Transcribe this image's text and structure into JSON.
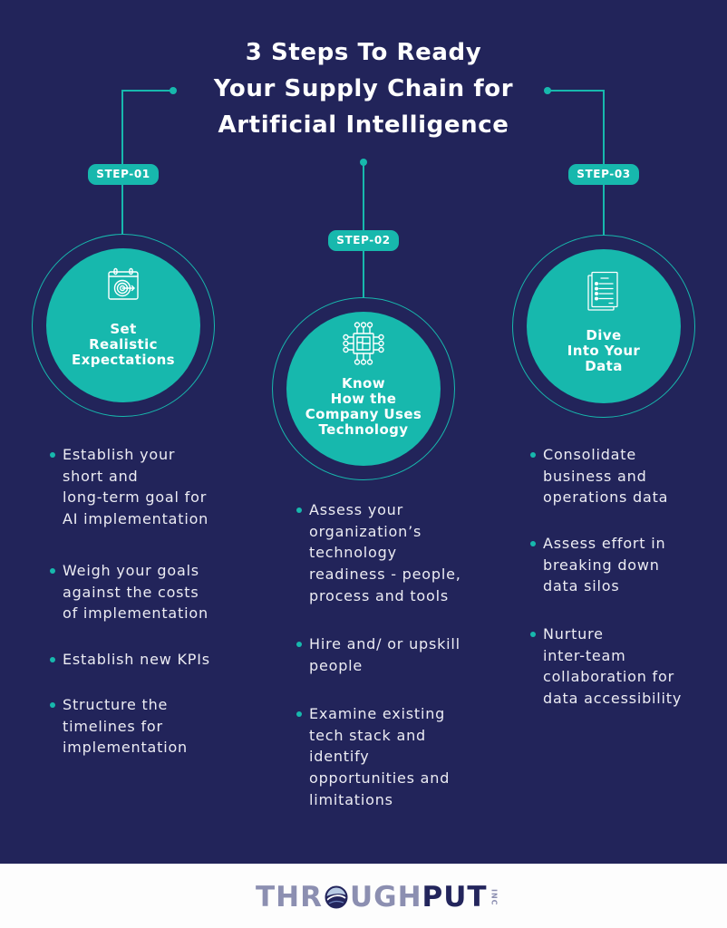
{
  "title": {
    "line1": "3 Steps To Ready",
    "line2": "Your Supply Chain for",
    "line3": "Artificial Intelligence"
  },
  "steps": [
    {
      "badge": "STEP-01",
      "icon": "calendar-target-icon",
      "title": [
        "Set",
        "Realistic",
        "Expectations"
      ],
      "bullets": [
        [
          "Establish your",
          "short and",
          "long-term goal for",
          "AI implementation"
        ],
        [
          "Weigh your goals",
          "against the costs",
          "of implementation"
        ],
        [
          "Establish new KPIs"
        ],
        [
          "Structure the",
          "timelines for",
          "implementation"
        ]
      ]
    },
    {
      "badge": "STEP-02",
      "icon": "microchip-icon",
      "title": [
        "Know",
        "How the",
        "Company Uses",
        "Technology"
      ],
      "bullets": [
        [
          "Assess your",
          "organization’s",
          "technology",
          "readiness - people,",
          "process and tools"
        ],
        [
          "Hire and/ or upskill",
          "people"
        ],
        [
          "Examine existing",
          "tech stack and",
          "identify",
          "opportunities and",
          "limitations"
        ]
      ]
    },
    {
      "badge": "STEP-03",
      "icon": "document-list-icon",
      "title": [
        "Dive",
        "Into Your",
        "Data"
      ],
      "bullets": [
        [
          "Consolidate",
          "business and",
          "operations data"
        ],
        [
          "Assess effort in",
          "breaking down",
          "data silos"
        ],
        [
          "Nurture",
          "inter-team",
          "collaboration for",
          "data accessibility"
        ]
      ]
    }
  ],
  "footer": {
    "logo": {
      "part_left": "THR",
      "globe_icon": "globe-icon",
      "part_middle": "UGH",
      "part_right": "PUT",
      "suffix": "INC"
    }
  },
  "colors": {
    "background": "#22245a",
    "accent": "#17b8ad",
    "heading_text": "#ffffff",
    "body_text": "#ececf3",
    "footer_background": "#fdfdfd",
    "logo_light": "#8c8fb1",
    "logo_dark": "#23255c"
  }
}
